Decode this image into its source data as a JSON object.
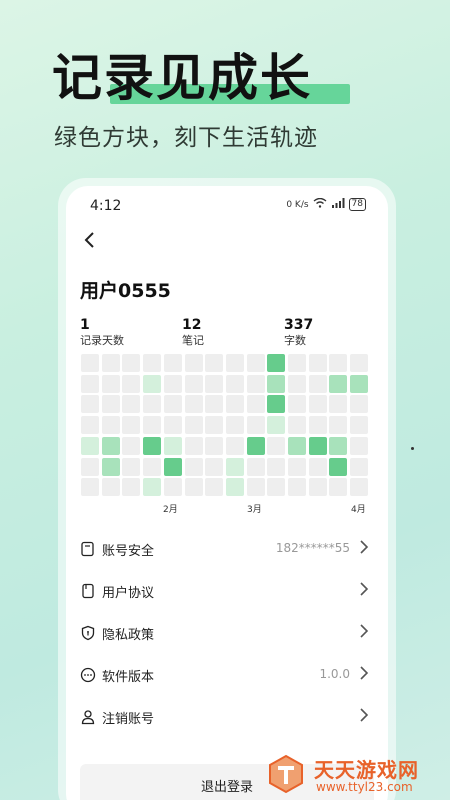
{
  "hero": {
    "title": "记录见成长",
    "subtitle": "绿色方块，刻下生活轨迹"
  },
  "status_bar": {
    "time": "4:12",
    "net_speed": "0 K/s",
    "battery": "78"
  },
  "profile": {
    "username": "用户0555",
    "stats": [
      {
        "num": "1",
        "label": "记录天数"
      },
      {
        "num": "12",
        "label": "笔记"
      },
      {
        "num": "337",
        "label": "字数"
      }
    ]
  },
  "heatmap": {
    "colors": {
      "empty": "#eeeeee",
      "light": "#d4f0dc",
      "mid": "#a8e2bb",
      "dark": "#66cc8c"
    },
    "rows": [
      [
        0,
        0,
        0,
        0,
        0,
        0,
        0,
        0,
        0,
        3,
        0,
        0,
        0,
        0
      ],
      [
        0,
        0,
        0,
        1,
        0,
        0,
        0,
        0,
        0,
        2,
        0,
        0,
        2,
        2
      ],
      [
        0,
        0,
        0,
        0,
        0,
        0,
        0,
        0,
        0,
        3,
        0,
        0,
        0,
        0
      ],
      [
        0,
        0,
        0,
        0,
        0,
        0,
        0,
        0,
        0,
        1,
        0,
        0,
        0,
        0
      ],
      [
        1,
        2,
        0,
        3,
        1,
        0,
        0,
        0,
        3,
        0,
        2,
        3,
        2,
        0
      ],
      [
        0,
        2,
        0,
        0,
        3,
        0,
        0,
        1,
        0,
        0,
        0,
        0,
        3,
        0
      ],
      [
        0,
        0,
        0,
        1,
        0,
        0,
        0,
        1,
        0,
        0,
        0,
        0,
        0,
        0
      ]
    ],
    "months": [
      "2月",
      "3月",
      "4月"
    ]
  },
  "menu": [
    {
      "label": "账号安全",
      "value": "182******55",
      "icon": "account-security-icon"
    },
    {
      "label": "用户协议",
      "value": "",
      "icon": "document-icon"
    },
    {
      "label": "隐私政策",
      "value": "",
      "icon": "shield-icon"
    },
    {
      "label": "软件版本",
      "value": "1.0.0",
      "icon": "more-dots-icon"
    },
    {
      "label": "注销账号",
      "value": "",
      "icon": "user-icon"
    }
  ],
  "logout_label": "退出登录",
  "watermark": {
    "title": "天天游戏网",
    "url": "www.ttyl23.com"
  }
}
